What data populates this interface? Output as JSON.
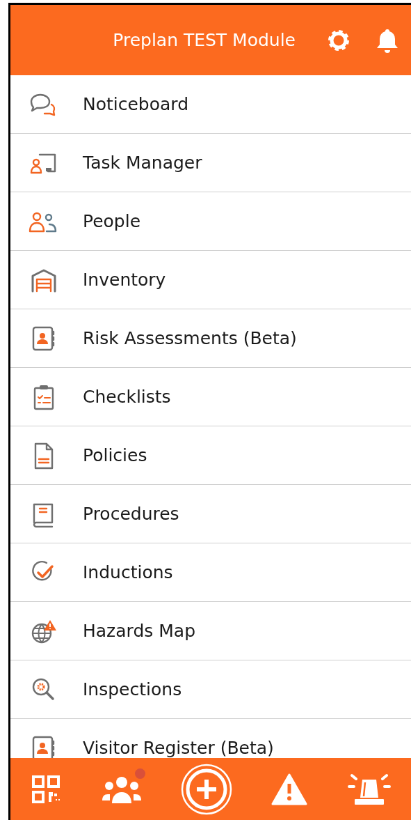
{
  "header": {
    "title": "Preplan TEST Module",
    "actions": [
      {
        "kind": "settings"
      },
      {
        "kind": "bell"
      }
    ]
  },
  "menu": [
    {
      "label": "Noticeboard",
      "kind": "chat"
    },
    {
      "label": "Task Manager",
      "kind": "task"
    },
    {
      "label": "People",
      "kind": "people"
    },
    {
      "label": "Inventory",
      "kind": "garage"
    },
    {
      "label": "Risk Assessments (Beta)",
      "kind": "contact"
    },
    {
      "label": "Checklists",
      "kind": "clipboard"
    },
    {
      "label": "Policies",
      "kind": "document"
    },
    {
      "label": "Procedures",
      "kind": "book"
    },
    {
      "label": "Inductions",
      "kind": "check"
    },
    {
      "label": "Hazards Map",
      "kind": "globe"
    },
    {
      "label": "Inspections",
      "kind": "inspect"
    },
    {
      "label": "Visitor Register (Beta)",
      "kind": "contact"
    }
  ],
  "bottom_nav": [
    {
      "kind": "qr",
      "dot": false
    },
    {
      "kind": "group",
      "dot": true
    },
    {
      "kind": "add",
      "dot": false
    },
    {
      "kind": "warning",
      "dot": false
    },
    {
      "kind": "siren",
      "dot": false
    }
  ]
}
